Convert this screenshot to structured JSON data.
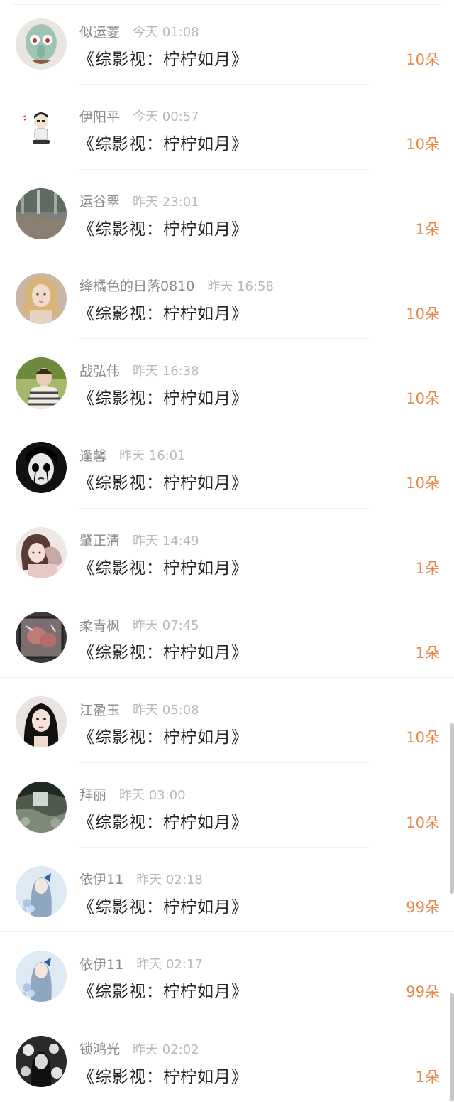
{
  "feed": {
    "items": [
      {
        "name": "似运菱",
        "time": "今天 01:08",
        "title": "《综影视：柠柠如月》",
        "amount": "10朵"
      },
      {
        "name": "伊阳平",
        "time": "今天 00:57",
        "title": "《综影视：柠柠如月》",
        "amount": "10朵"
      },
      {
        "name": "运谷翠",
        "time": "昨天 23:01",
        "title": "《综影视：柠柠如月》",
        "amount": "1朵"
      },
      {
        "name": "绛橘色的日落0810",
        "time": "昨天 16:58",
        "title": "《综影视：柠柠如月》",
        "amount": "10朵"
      },
      {
        "name": "战弘伟",
        "time": "昨天 16:38",
        "title": "《综影视：柠柠如月》",
        "amount": "10朵"
      },
      {
        "name": "逢馨",
        "time": "昨天 16:01",
        "title": "《综影视：柠柠如月》",
        "amount": "10朵"
      },
      {
        "name": "肇正清",
        "time": "昨天 14:49",
        "title": "《综影视：柠柠如月》",
        "amount": "1朵"
      },
      {
        "name": "柔青枫",
        "time": "昨天 07:45",
        "title": "《综影视：柠柠如月》",
        "amount": "1朵"
      },
      {
        "name": "江盈玉",
        "time": "昨天 05:08",
        "title": "《综影视：柠柠如月》",
        "amount": "10朵"
      },
      {
        "name": "拜丽",
        "time": "昨天 03:00",
        "title": "《综影视：柠柠如月》",
        "amount": "10朵"
      },
      {
        "name": "依伊11",
        "time": "昨天 02:18",
        "title": "《综影视：柠柠如月》",
        "amount": "99朵"
      },
      {
        "name": "依伊11",
        "time": "昨天 02:17",
        "title": "《综影视：柠柠如月》",
        "amount": "99朵"
      },
      {
        "name": "锁鸿光",
        "time": "昨天 02:02",
        "title": "《综影视：柠柠如月》",
        "amount": "1朵"
      }
    ]
  },
  "colors": {
    "accent": "#e58a4e",
    "name": "#8a8a8a",
    "time": "#b9b9b9",
    "title": "#222222"
  }
}
